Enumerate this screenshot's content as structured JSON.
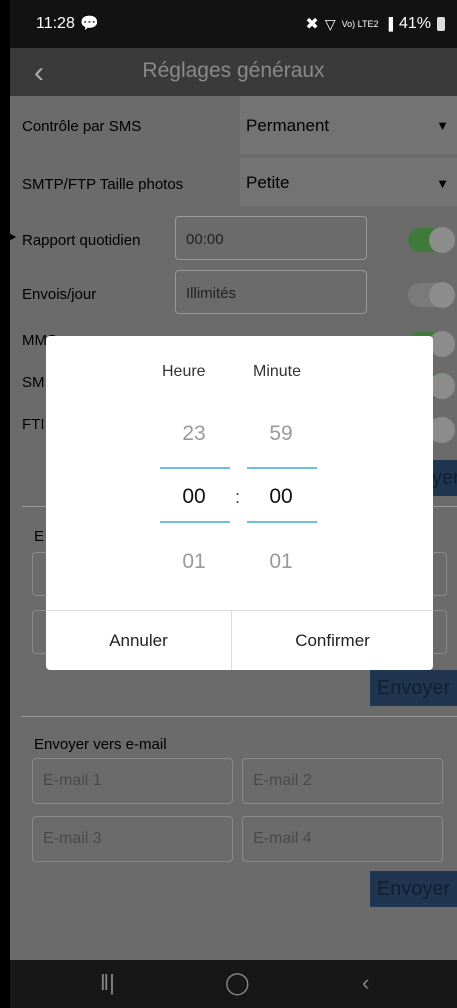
{
  "status_bar": {
    "time": "11:28",
    "battery": "41%",
    "network": "Vo) LTE2"
  },
  "app_bar": {
    "title": "Réglages généraux"
  },
  "settings": {
    "sms_control_label": "Contrôle par SMS",
    "sms_control_value": "Permanent",
    "photo_size_label": "SMTP/FTP Taille photos",
    "photo_size_value": "Petite",
    "daily_report_label": "Rapport quotidien",
    "daily_report_value": "00:00",
    "sends_per_day_label": "Envois/jour",
    "sends_per_day_value": "Illimités",
    "mms_label": "MMS",
    "sm_label": "SM",
    "ftp_label": "FTI",
    "section2_label": "E",
    "envoyer_partial": "yer",
    "envoyer_1": "Envoyer",
    "email_section_label": "Envoyer vers e-mail",
    "email_1": "E-mail 1",
    "email_2": "E-mail 2",
    "email_3": "E-mail 3",
    "email_4": "E-mail 4",
    "envoyer_2": "Envoyer"
  },
  "toggles": {
    "daily_report": true,
    "sends_per_day": false,
    "mms": true,
    "sm": true,
    "ftp": false
  },
  "dialog": {
    "hour_header": "Heure",
    "minute_header": "Minute",
    "hour_prev": "23",
    "hour_current": "00",
    "hour_next": "01",
    "minute_prev": "59",
    "minute_current": "00",
    "minute_next": "01",
    "separator": ":",
    "cancel": "Annuler",
    "confirm": "Confirmer"
  },
  "colors": {
    "accent_toggle": "#4cb648",
    "picker_underline": "#6ec0d8",
    "send_button": "#1f3550"
  }
}
